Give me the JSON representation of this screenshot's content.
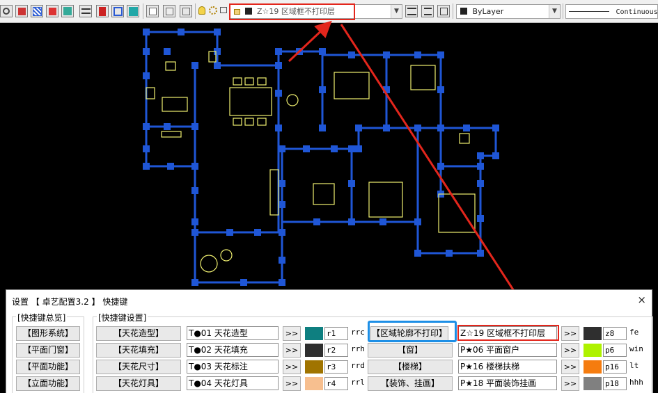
{
  "toolbar": {
    "layer_combo_text": "Z☆19 区域框不打印层",
    "color_combo_text": "ByLayer",
    "linetype_combo_text": "Continuous"
  },
  "dialog": {
    "title": "设置 【 卓艺配置3.2 】 快捷键",
    "close_label": "×",
    "overview_label": "[快捷键总览]",
    "settings_label": "[快捷键设置]",
    "left_buttons": [
      "【图形系统】",
      "【平面门窗】",
      "【平面功能】",
      "【立面功能】"
    ],
    "middle_rows": [
      {
        "button": "【天花造型】",
        "layer": "T●01 天花造型",
        "arrow": ">>",
        "color": "#0e7f80",
        "color_code": "r1",
        "command": "rrc"
      },
      {
        "button": "【天花填充】",
        "layer": "T●02 天花填充",
        "arrow": ">>",
        "color": "#2f2f2f",
        "color_code": "r2",
        "command": "rrh"
      },
      {
        "button": "【天花尺寸】",
        "layer": "T●03 天花标注",
        "arrow": ">>",
        "color": "#a07400",
        "color_code": "r3",
        "command": "rrd"
      },
      {
        "button": "【天花灯具】",
        "layer": "T●04 天花灯具",
        "arrow": ">>",
        "color": "#f7bf8f",
        "color_code": "r4",
        "command": "rrl"
      }
    ],
    "right_rows": [
      {
        "button": "【区域轮廓不打印】",
        "layer": "Z☆19 区域框不打印层",
        "arrow": ">>",
        "color": "#2f2f2f",
        "color_code": "z8",
        "command": "fe"
      },
      {
        "button": "【窗】",
        "layer": "P★06 平面窗户",
        "arrow": ">>",
        "color": "#aef200",
        "color_code": "p6",
        "command": "win"
      },
      {
        "button": "【楼梯】",
        "layer": "P★16 楼梯扶梯",
        "arrow": ">>",
        "color": "#f57c0f",
        "color_code": "p16",
        "command": "lt"
      },
      {
        "button": "【装饰、挂画】",
        "layer": "P★18 平面装饰挂画",
        "arrow": ">>",
        "color": "#808080",
        "color_code": "p18",
        "command": "hhh"
      }
    ]
  },
  "colors": {
    "wall_blue": "#1f56d6",
    "furniture_yellow": "#f0f070",
    "annotation_red": "#e3261c",
    "highlight_blue": "#1d8fe6"
  }
}
